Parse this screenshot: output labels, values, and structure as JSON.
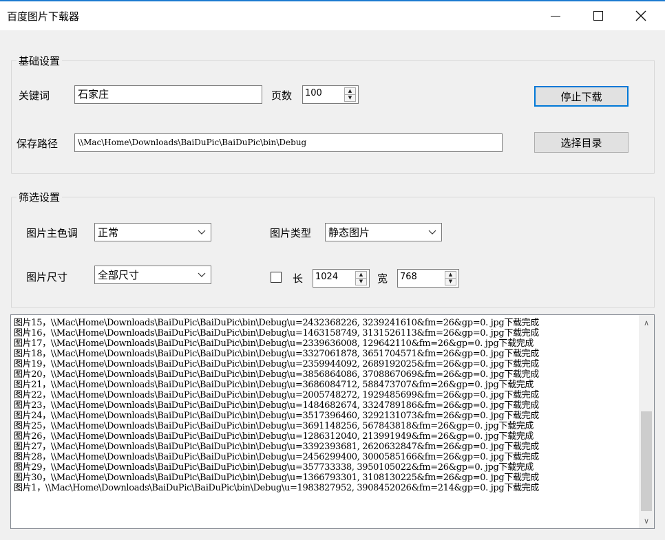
{
  "window": {
    "title": "百度图片下载器",
    "controls": {
      "minimize": "—",
      "maximize": "☐",
      "close": "✕"
    }
  },
  "basic": {
    "group_label": "基础设置",
    "keyword_label": "关键词",
    "keyword_value": "石家庄",
    "pages_label": "页数",
    "pages_value": "100",
    "stop_button": "停止下载",
    "path_label": "保存路径",
    "path_value": "\\\\Mac\\Home\\Downloads\\BaiDuPic\\BaiDuPic\\bin\\Debug",
    "browse_button": "选择目录"
  },
  "filter": {
    "group_label": "筛选设置",
    "tone_label": "图片主色调",
    "tone_value": "正常",
    "type_label": "图片类型",
    "type_value": "静态图片",
    "size_label": "图片尺寸",
    "size_value": "全部尺寸",
    "custom_checked": false,
    "length_label": "长",
    "length_value": "1024",
    "width_label": "宽",
    "width_value": "768"
  },
  "log": {
    "lines": [
      "图片15，\\\\Mac\\Home\\Downloads\\BaiDuPic\\BaiDuPic\\bin\\Debug\\u=2432368226, 3239241610&fm=26&gp=0. jpg下载完成",
      "图片16，\\\\Mac\\Home\\Downloads\\BaiDuPic\\BaiDuPic\\bin\\Debug\\u=1463158749, 3131526113&fm=26&gp=0. jpg下载完成",
      "图片17，\\\\Mac\\Home\\Downloads\\BaiDuPic\\BaiDuPic\\bin\\Debug\\u=2339636008, 129642110&fm=26&gp=0. jpg下载完成",
      "图片18，\\\\Mac\\Home\\Downloads\\BaiDuPic\\BaiDuPic\\bin\\Debug\\u=3327061878, 3651704571&fm=26&gp=0. jpg下载完成",
      "图片19，\\\\Mac\\Home\\Downloads\\BaiDuPic\\BaiDuPic\\bin\\Debug\\u=2359944092, 2689192025&fm=26&gp=0. jpg下载完成",
      "图片20，\\\\Mac\\Home\\Downloads\\BaiDuPic\\BaiDuPic\\bin\\Debug\\u=3856864086, 3708867069&fm=26&gp=0. jpg下载完成",
      "图片21，\\\\Mac\\Home\\Downloads\\BaiDuPic\\BaiDuPic\\bin\\Debug\\u=3686084712, 588473707&fm=26&gp=0. jpg下载完成",
      "图片22，\\\\Mac\\Home\\Downloads\\BaiDuPic\\BaiDuPic\\bin\\Debug\\u=2005748272, 1929485699&fm=26&gp=0. jpg下载完成",
      "图片23，\\\\Mac\\Home\\Downloads\\BaiDuPic\\BaiDuPic\\bin\\Debug\\u=1484682674, 3324789186&fm=26&gp=0. jpg下载完成",
      "图片24，\\\\Mac\\Home\\Downloads\\BaiDuPic\\BaiDuPic\\bin\\Debug\\u=3517396460, 3292131073&fm=26&gp=0. jpg下载完成",
      "图片25，\\\\Mac\\Home\\Downloads\\BaiDuPic\\BaiDuPic\\bin\\Debug\\u=3691148256, 567843818&fm=26&gp=0. jpg下载完成",
      "图片26，\\\\Mac\\Home\\Downloads\\BaiDuPic\\BaiDuPic\\bin\\Debug\\u=1286312040, 213991949&fm=26&gp=0. jpg下载完成",
      "图片27，\\\\Mac\\Home\\Downloads\\BaiDuPic\\BaiDuPic\\bin\\Debug\\u=3392393681, 2620632847&fm=26&gp=0. jpg下载完成",
      "图片28，\\\\Mac\\Home\\Downloads\\BaiDuPic\\BaiDuPic\\bin\\Debug\\u=2456299400, 3000585166&fm=26&gp=0. jpg下载完成",
      "图片29，\\\\Mac\\Home\\Downloads\\BaiDuPic\\BaiDuPic\\bin\\Debug\\u=357733338, 3950105022&fm=26&gp=0. jpg下载完成",
      "图片30，\\\\Mac\\Home\\Downloads\\BaiDuPic\\BaiDuPic\\bin\\Debug\\u=1366793301, 3108130225&fm=26&gp=0. jpg下载完成",
      "图片1，\\\\Mac\\Home\\Downloads\\BaiDuPic\\BaiDuPic\\bin\\Debug\\u=1983827952, 3908452026&fm=214&gp=0. jpg下载完成"
    ]
  },
  "icons": {
    "spin_up": "▲",
    "spin_down": "▼",
    "scroll_up": "∧",
    "scroll_down": "∨"
  }
}
